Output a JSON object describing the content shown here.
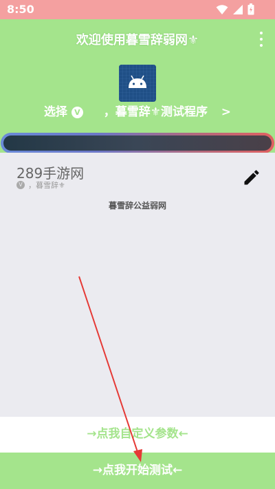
{
  "status_bar": {
    "time": "8:50",
    "icons": [
      "wifi-icon",
      "signal-icon",
      "battery-icon"
    ]
  },
  "header": {
    "title": "欢迎使用暮雪辞弱网⚜",
    "menu_icon": "more-vert-icon"
  },
  "selector": {
    "icon": "android-icon",
    "prefix": "选择",
    "badge": "V",
    "app_name": "，暮雪辞⚜测试程序",
    "chevron": ">"
  },
  "game": {
    "title": "289手游网",
    "badge": "V",
    "subtitle": "，暮雪辞⚜",
    "edit_icon": "pencil-icon",
    "note": "暮雪辞公益弱网"
  },
  "buttons": {
    "custom_params": "→点我自定义参数←",
    "start_test": "→点我开始测试←"
  },
  "colors": {
    "accent": "#a4e48c",
    "status_bar": "#f4a0a0",
    "panel": "#ebebf0",
    "annotation_arrow": "#e53935"
  }
}
